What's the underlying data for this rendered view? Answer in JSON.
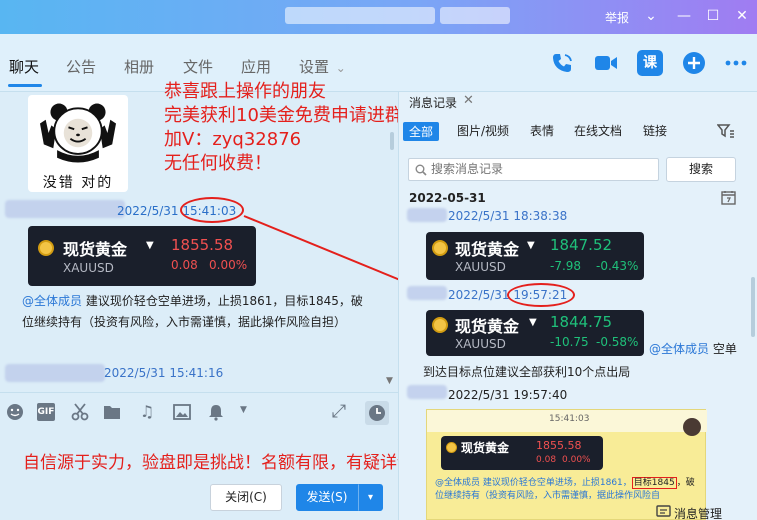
{
  "window": {
    "report_label": "举报",
    "controls": [
      "⌄",
      "—",
      "☐",
      "✕"
    ]
  },
  "tabs": [
    "聊天",
    "公告",
    "相册",
    "文件",
    "应用",
    "设置"
  ],
  "settings_caret": "⌄",
  "toolbar_icons": [
    "phone-icon",
    "video-icon",
    "class-icon",
    "add-icon",
    "more-icon"
  ],
  "tool_icon_labels": {
    "class": "课"
  },
  "colors": {
    "accent": "#1f86e8",
    "red_overlay": "#e4201c",
    "price_red": "#f05050",
    "price_green": "#1fc07a"
  },
  "chat": {
    "sticker_caption": "没错 对的",
    "msg1_time": "2022/5/31 15:41:03",
    "card": {
      "title": "现货黄金",
      "symbol": "XAUUSD",
      "price": "1855.58",
      "change": "0.08",
      "change_pct": "0.00%"
    },
    "mention": "@全体成员",
    "msg_text": " 建议现价轻仓空单进场，止损1861，目标1845，破位继续持有（投资有风险，入市需谨慎，据此操作风险自担）",
    "msg2_time": "2022/5/31 15:41:16"
  },
  "overlay": {
    "line1": "恭喜跟上操作的朋友",
    "line2": "完美获利10美金免费申请进群",
    "line3": "加V：zyq32876",
    "line4": "无任何收费！",
    "bottom": "自信源于实力，验盘即是挑战！名额有限，有疑详询!"
  },
  "input_toolbar_icons": [
    "emoji-icon",
    "gif-icon",
    "scissors-icon",
    "folder-icon",
    "music-icon",
    "image-icon",
    "bell-icon",
    "expand-icon",
    "clock-icon"
  ],
  "input_toolbar_labels": {
    "gif": "GIF",
    "music": "♫",
    "expand": "⤢"
  },
  "buttons": {
    "close": "关闭(C)",
    "send": "发送(S)",
    "send_caret": "▾"
  },
  "panel": {
    "title": "消息记录",
    "close_x": "✕",
    "filters": [
      "全部",
      "图片/视频",
      "表情",
      "在线文档",
      "链接"
    ],
    "search_placeholder": "搜索消息记录",
    "search_button": "搜索",
    "date": "2022-05-31",
    "r1_time": "2022/5/31 18:38:38",
    "card1": {
      "title": "现货黄金",
      "symbol": "XAUUSD",
      "price": "1847.52",
      "change": "-7.98",
      "change_pct": "-0.43%"
    },
    "r2_time": "2022/5/31 19:57:21",
    "card2": {
      "title": "现货黄金",
      "symbol": "XAUUSD",
      "price": "1844.75",
      "change": "-10.75",
      "change_pct": "-0.58%"
    },
    "mention": "@全体成员",
    "mention_tail": " 空单",
    "result_text": "到达目标点位建议全部获利10个点出局",
    "r3_time": "2022/5/31 19:57:40",
    "shot": {
      "time": "15:41:03",
      "title": "现货黄金",
      "price": "1855.58",
      "change": "0.08",
      "change_pct": "0.00%",
      "text_a": "@全体成员 建议现价轻仓空单进场，止损1861，",
      "target": "目标1845",
      "text_b": "，破",
      "text_c": "位继续持有（投资有风险，入市需谨慎，据此操作风险自"
    },
    "footer": "消息管理"
  }
}
